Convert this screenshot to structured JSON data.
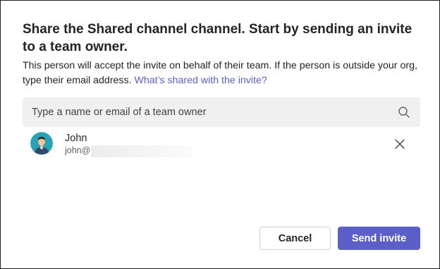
{
  "dialog": {
    "title": "Share the Shared channel channel. Start by sending an invite to a team owner.",
    "description": "This person will accept the invite on behalf of their team. If the person is outside your org, type their email address.",
    "link_text": "What’s shared with the invite?"
  },
  "search": {
    "placeholder": "Type a name or email of a team owner",
    "icon": "search-icon"
  },
  "selected_person": {
    "name": "John",
    "email": "john@",
    "avatar_icon": "avatar-icon",
    "remove_icon": "close-icon"
  },
  "buttons": {
    "cancel": "Cancel",
    "send": "Send invite"
  },
  "colors": {
    "accent": "#5b5fc7",
    "avatar_bg": "#26a3b5"
  }
}
